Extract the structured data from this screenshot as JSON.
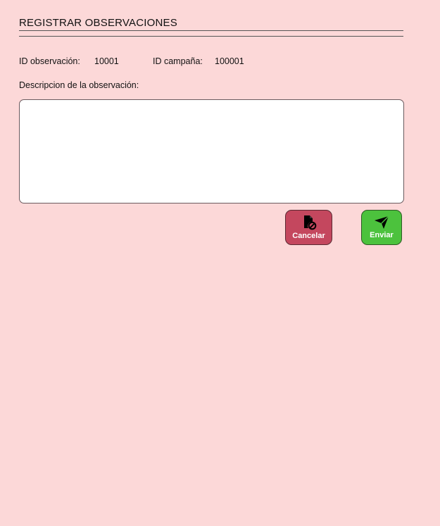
{
  "header": {
    "title": "REGISTRAR OBSERVACIONES"
  },
  "meta": {
    "obs_label": "ID observación:",
    "obs_value": "10001",
    "camp_label": "ID campaña:",
    "camp_value": "100001"
  },
  "form": {
    "description_label": "Descripcion de la observación:",
    "description_value": ""
  },
  "actions": {
    "cancel_label": "Cancelar",
    "cancel_icon": "file-cancel-icon",
    "cancel_color": "#c4475e",
    "send_label": "Enviar",
    "send_icon": "send-icon",
    "send_color": "#4cc23d"
  }
}
